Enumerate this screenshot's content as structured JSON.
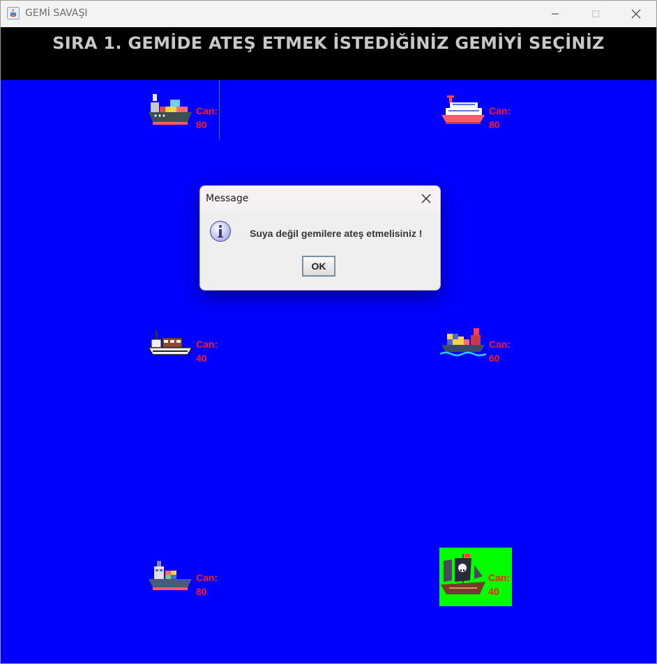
{
  "window": {
    "title": "GEMİ SAVAŞI"
  },
  "header": {
    "text": "SIRA 1. GEMİDE ATEŞ ETMEK İSTEDİĞİNİZ GEMİYİ SEÇİNİZ"
  },
  "ships": [
    {
      "label": "Can:",
      "health": "80",
      "icon": "cargo-ship-icon"
    },
    {
      "label": "Can:",
      "health": "80",
      "icon": "cruise-ship-icon"
    },
    {
      "label": "Can:",
      "health": "40",
      "icon": "freighter-icon"
    },
    {
      "label": "Can:",
      "health": "60",
      "icon": "container-ship-icon"
    },
    {
      "label": "Can:",
      "health": "80",
      "icon": "tanker-ship-icon"
    },
    {
      "label": "Can:",
      "health": "40",
      "icon": "pirate-ship-icon",
      "highlight": "#00ff00"
    }
  ],
  "dialog": {
    "title": "Message",
    "message": "Suya değil gemilere ateş etmelisiniz !",
    "ok_label": "OK",
    "icon": "info-icon"
  },
  "colors": {
    "sea": "#0000ff",
    "header": "#000000",
    "health_text": "#ff1a1a",
    "selected": "#00ff00"
  }
}
